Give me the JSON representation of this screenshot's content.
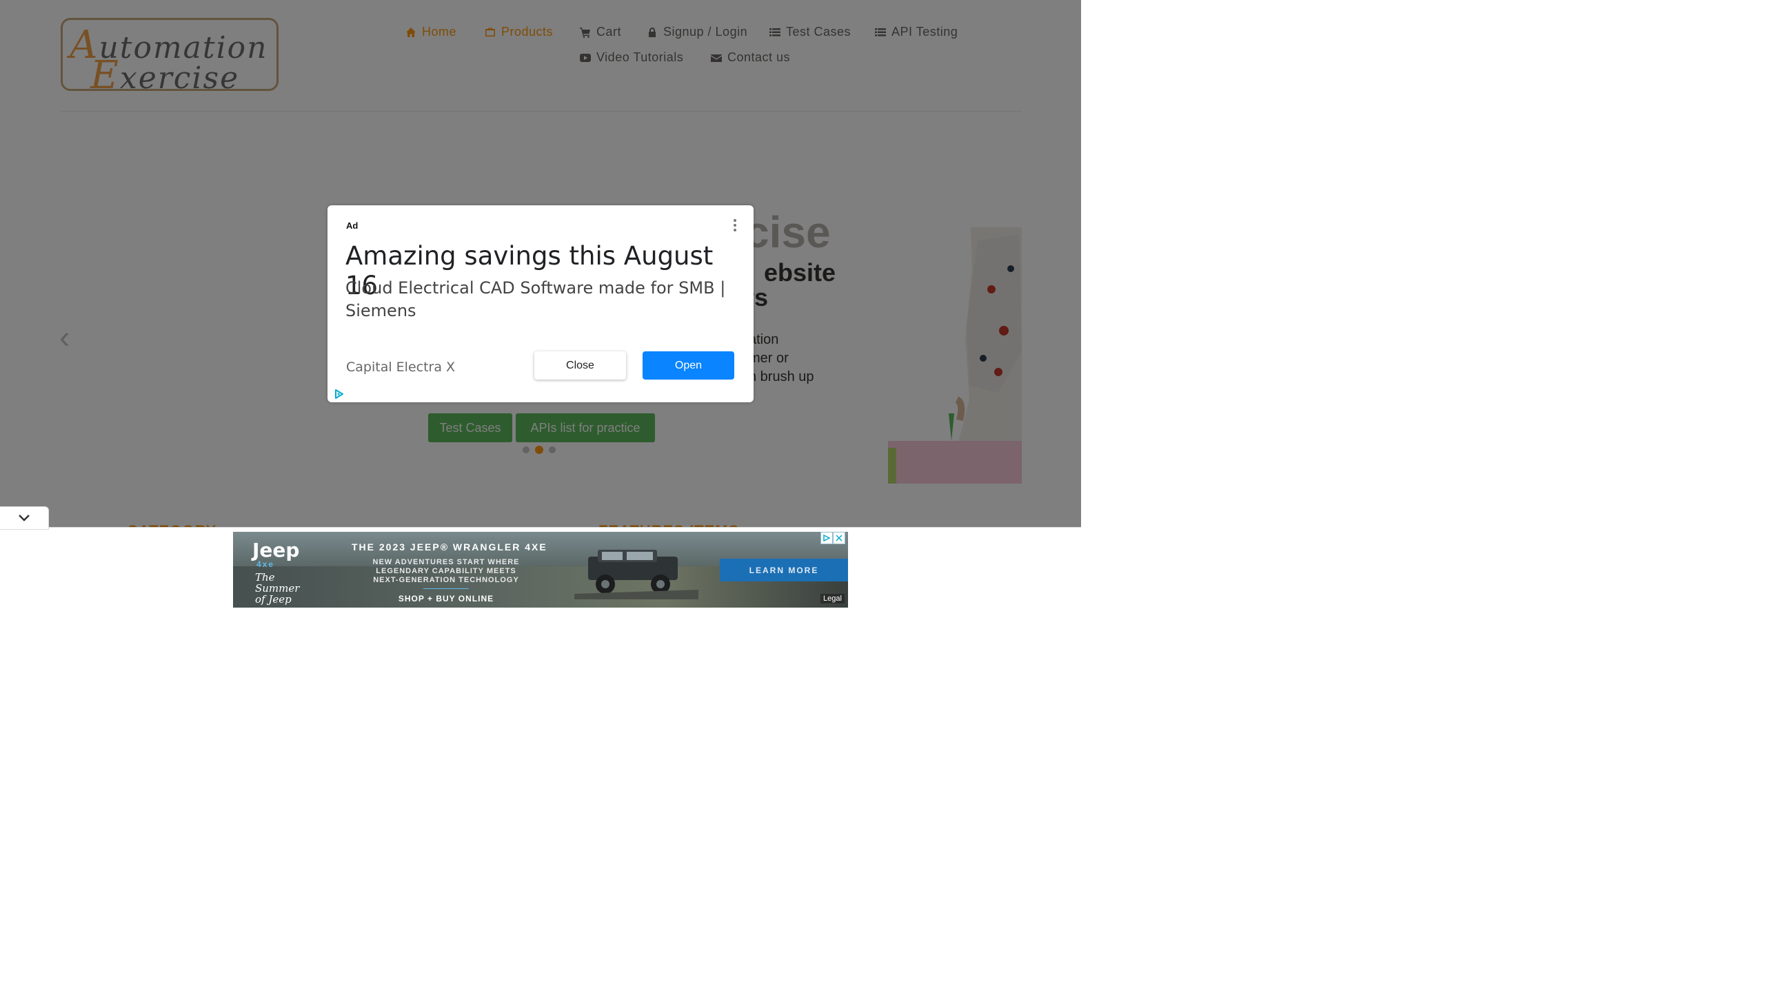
{
  "site": {
    "logo": {
      "line1_cap": "A",
      "line1_rest": "utomation",
      "line2_cap": "E",
      "line2_rest": "xercise"
    },
    "nav": [
      {
        "label": "Home",
        "icon": "home-icon",
        "active": true
      },
      {
        "label": "Products",
        "icon": "briefcase-icon",
        "active": true
      },
      {
        "label": "Cart",
        "icon": "cart-icon"
      },
      {
        "label": "Signup / Login",
        "icon": "lock-icon"
      },
      {
        "label": "Test Cases",
        "icon": "list-icon"
      },
      {
        "label": "API Testing",
        "icon": "list-icon"
      },
      {
        "label": "Video Tutorials",
        "icon": "youtube-icon"
      },
      {
        "label": "Contact us",
        "icon": "envelope-icon"
      }
    ],
    "accent_color": "#fe980f"
  },
  "hero": {
    "title_visible": "cise",
    "subtitle_line1": "ebsite",
    "subtitle_line2": "rs",
    "text_line1": "ation",
    "text_line2": "mer or",
    "text_line3": "n brush up",
    "btn_test_cases": "Test Cases",
    "btn_apis": "APIs list for practice",
    "prev_arrow": "‹",
    "next_arrow": "›",
    "active_slide": 2,
    "slide_count": 3
  },
  "sections": {
    "category": "CATEGORY",
    "features": "FEATURES ITEMS"
  },
  "ad_modal": {
    "ad_label": "Ad",
    "title": "Amazing savings this August 16",
    "description": "Cloud Electrical CAD Software made for SMB | Siemens",
    "advertiser": "Capital Electra X",
    "close_label": "Close",
    "open_label": "Open",
    "open_color": "#0a84ff"
  },
  "banner_ad": {
    "brand": "Jeep",
    "brand_sub": "4xe",
    "tagline": "The Summer of Jeep",
    "headline": "THE 2023 JEEP® WRANGLER 4XE",
    "line1": "NEW ADVENTURES START WHERE",
    "line2": "LEGENDARY CAPABILITY MEETS",
    "line3": "NEXT-GENERATION TECHNOLOGY",
    "shop": "SHOP + BUY ONLINE",
    "cta": "LEARN MORE",
    "legal": "Legal"
  }
}
